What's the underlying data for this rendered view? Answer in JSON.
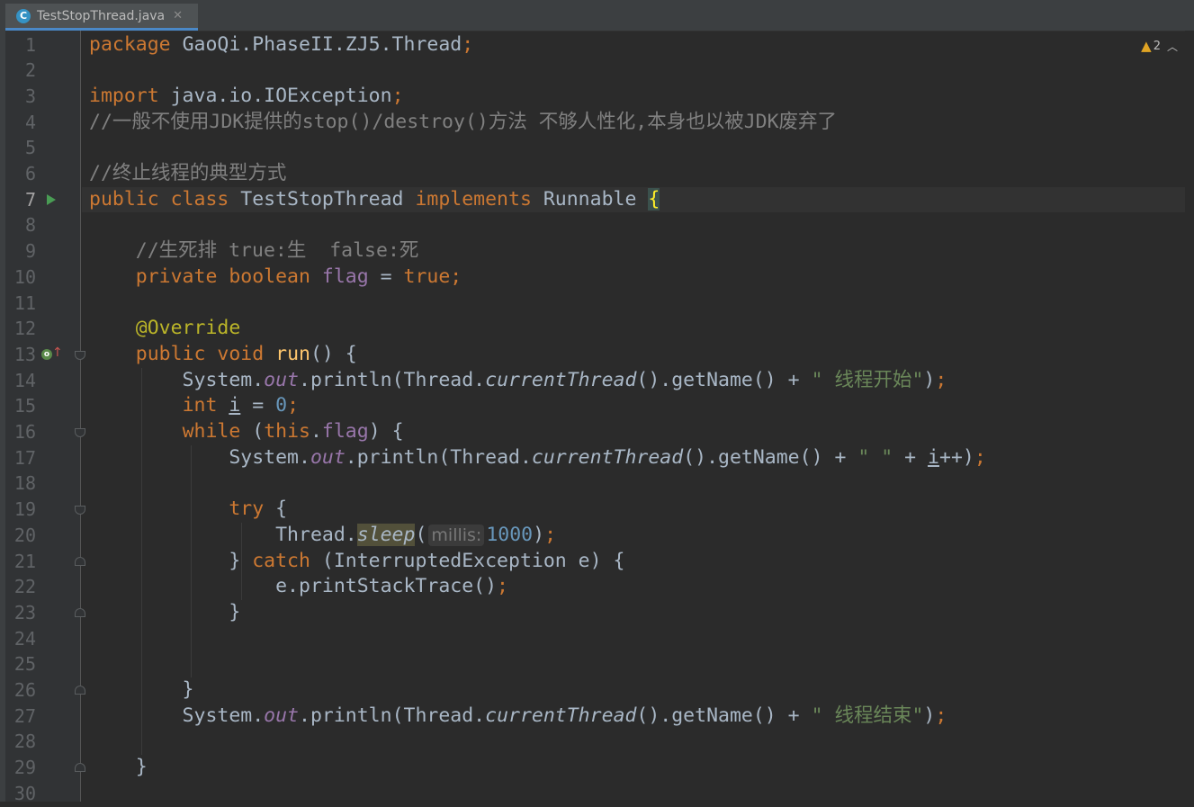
{
  "tab": {
    "icon": "java-class-icon",
    "icon_letter": "C",
    "filename": "TestStopThread.java",
    "close": "✕"
  },
  "inspections": {
    "icon": "warning-icon",
    "count": "2"
  },
  "parameter_hint": "millis:",
  "lines": [
    {
      "no": "1",
      "segs": [
        [
          "kw",
          "package "
        ],
        [
          "",
          "GaoQi.PhaseII.ZJ5.Thread"
        ],
        [
          "kw",
          ";"
        ]
      ]
    },
    {
      "no": "2",
      "segs": []
    },
    {
      "no": "3",
      "segs": [
        [
          "kw",
          "import "
        ],
        [
          "",
          "java.io.IOException"
        ],
        [
          "kw",
          ";"
        ]
      ]
    },
    {
      "no": "4",
      "segs": [
        [
          "cmt",
          "//一般不使用JDK提供的stop()/destroy()方法 不够人性化,本身也以被JDK废弃了"
        ]
      ]
    },
    {
      "no": "5",
      "segs": []
    },
    {
      "no": "6",
      "segs": [
        [
          "cmt",
          "//终止线程的典型方式"
        ]
      ]
    },
    {
      "no": "7",
      "segs": [
        [
          "kw",
          "public class "
        ],
        [
          "",
          "TestStopThread "
        ],
        [
          "kw",
          "implements "
        ],
        [
          "",
          "Runnable "
        ],
        [
          "brace-hl",
          "{"
        ]
      ]
    },
    {
      "no": "8",
      "segs": []
    },
    {
      "no": "9",
      "segs": [
        [
          "",
          "    "
        ],
        [
          "cmt",
          "//生死排 true:生  false:死"
        ]
      ]
    },
    {
      "no": "10",
      "segs": [
        [
          "",
          "    "
        ],
        [
          "kw",
          "private boolean "
        ],
        [
          "fld",
          "flag"
        ],
        [
          "",
          " = "
        ],
        [
          "kw",
          "true;"
        ]
      ]
    },
    {
      "no": "11",
      "segs": []
    },
    {
      "no": "12",
      "segs": [
        [
          "",
          "    "
        ],
        [
          "ann",
          "@Override"
        ]
      ]
    },
    {
      "no": "13",
      "segs": [
        [
          "",
          "    "
        ],
        [
          "kw",
          "public void "
        ],
        [
          "fn",
          "run"
        ],
        [
          "",
          "() {"
        ]
      ]
    },
    {
      "no": "14",
      "segs": [
        [
          "",
          "        System."
        ],
        [
          "fld ital",
          "out"
        ],
        [
          "",
          ".println(Thread."
        ],
        [
          "ital",
          "currentThread"
        ],
        [
          "",
          "().getName() + "
        ],
        [
          "str",
          "\" 线程开始\""
        ],
        [
          "",
          ")"
        ],
        [
          "kw",
          ";"
        ]
      ]
    },
    {
      "no": "15",
      "segs": [
        [
          "",
          "        "
        ],
        [
          "kw",
          "int "
        ],
        [
          "ul",
          "i"
        ],
        [
          "",
          " = "
        ],
        [
          "num",
          "0"
        ],
        [
          "kw",
          ";"
        ]
      ]
    },
    {
      "no": "16",
      "segs": [
        [
          "",
          "        "
        ],
        [
          "kw",
          "while "
        ],
        [
          "",
          "("
        ],
        [
          "kw",
          "this"
        ],
        [
          "",
          "."
        ],
        [
          "fld",
          "flag"
        ],
        [
          "",
          ") {"
        ]
      ]
    },
    {
      "no": "17",
      "segs": [
        [
          "",
          "            System."
        ],
        [
          "fld ital",
          "out"
        ],
        [
          "",
          ".println(Thread."
        ],
        [
          "ital",
          "currentThread"
        ],
        [
          "",
          "().getName() + "
        ],
        [
          "str",
          "\" \""
        ],
        [
          "",
          " + "
        ],
        [
          "ul",
          "i"
        ],
        [
          "",
          "++)"
        ],
        [
          "kw",
          ";"
        ]
      ]
    },
    {
      "no": "18",
      "segs": []
    },
    {
      "no": "19",
      "segs": [
        [
          "",
          "            "
        ],
        [
          "kw",
          "try "
        ],
        [
          "",
          "{"
        ]
      ]
    },
    {
      "no": "20",
      "segs": [
        [
          "",
          "                Thread."
        ],
        [
          "ital sleep-hl",
          "sleep"
        ],
        [
          "",
          "("
        ],
        [
          "hint",
          ""
        ],
        [
          "num",
          "1000"
        ],
        [
          "",
          ")"
        ],
        [
          "kw",
          ";"
        ]
      ]
    },
    {
      "no": "21",
      "segs": [
        [
          "",
          "            } "
        ],
        [
          "kw",
          "catch "
        ],
        [
          "",
          "(InterruptedException e) {"
        ]
      ]
    },
    {
      "no": "22",
      "segs": [
        [
          "",
          "                e.printStackTrace()"
        ],
        [
          "kw",
          ";"
        ]
      ]
    },
    {
      "no": "23",
      "segs": [
        [
          "",
          "            }"
        ]
      ]
    },
    {
      "no": "24",
      "segs": []
    },
    {
      "no": "25",
      "segs": []
    },
    {
      "no": "26",
      "segs": [
        [
          "",
          "        }"
        ]
      ]
    },
    {
      "no": "27",
      "segs": [
        [
          "",
          "        System."
        ],
        [
          "fld ital",
          "out"
        ],
        [
          "",
          ".println(Thread."
        ],
        [
          "ital",
          "currentThread"
        ],
        [
          "",
          "().getName() + "
        ],
        [
          "str",
          "\" 线程结束\""
        ],
        [
          "",
          ")"
        ],
        [
          "kw",
          ";"
        ]
      ]
    },
    {
      "no": "28",
      "segs": []
    },
    {
      "no": "29",
      "segs": [
        [
          "",
          "    }"
        ]
      ]
    },
    {
      "no": "30",
      "segs": []
    }
  ],
  "current_line": "7",
  "gutter_markers": {
    "run": {
      "line": "7",
      "icon": "run-icon"
    },
    "override": {
      "line": "13",
      "icon": "override-method-icon",
      "letter": "o",
      "arrow": "↑"
    },
    "fold_open": [
      "13",
      "16",
      "19"
    ],
    "fold_close": [
      "21",
      "23",
      "26",
      "29"
    ]
  }
}
